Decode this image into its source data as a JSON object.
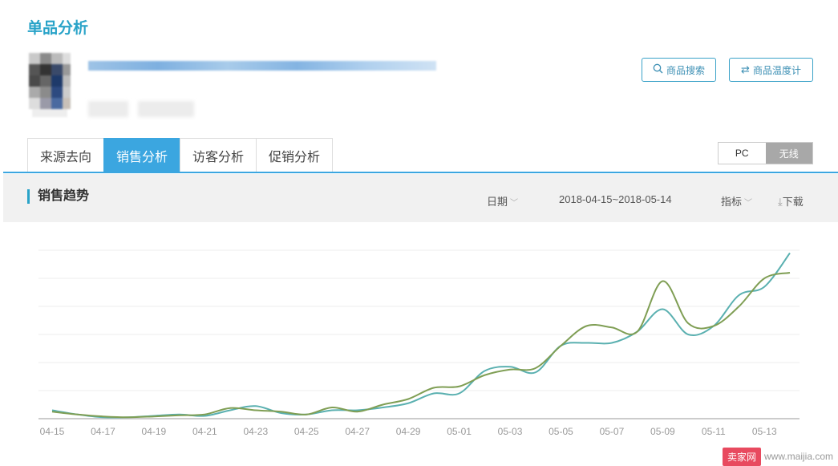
{
  "page_title": "单品分析",
  "header_buttons": {
    "search_label": "商品搜索",
    "thermo_label": "商品温度计"
  },
  "tabs": [
    {
      "label": "来源去向",
      "active": false
    },
    {
      "label": "销售分析",
      "active": true
    },
    {
      "label": "访客分析",
      "active": false
    },
    {
      "label": "促销分析",
      "active": false
    }
  ],
  "device_toggle": {
    "pc": "PC",
    "wireless": "无线",
    "selected": "无线"
  },
  "section": {
    "title": "销售趋势",
    "date_label": "日期",
    "date_range": "2018-04-15~2018-05-14",
    "metric_label": "指标",
    "download_label": "下载"
  },
  "watermark": {
    "logo": "卖家网",
    "url": "www.maijia.com"
  },
  "colors": {
    "accent": "#29a3c8",
    "tab_active": "#3ba6e0",
    "series_teal": "#5ab0b0",
    "series_olive": "#7f9e54"
  },
  "chart_data": {
    "type": "line",
    "x": [
      "04-15",
      "04-16",
      "04-17",
      "04-18",
      "04-19",
      "04-20",
      "04-21",
      "04-22",
      "04-23",
      "04-24",
      "04-25",
      "04-26",
      "04-27",
      "04-28",
      "04-29",
      "04-30",
      "05-01",
      "05-02",
      "05-03",
      "05-04",
      "05-05",
      "05-06",
      "05-07",
      "05-08",
      "05-09",
      "05-10",
      "05-11",
      "05-12",
      "05-13",
      "05-14"
    ],
    "x_ticks": [
      "04-15",
      "04-17",
      "04-19",
      "04-21",
      "04-23",
      "04-25",
      "04-27",
      "04-29",
      "05-01",
      "05-03",
      "05-05",
      "05-07",
      "05-09",
      "05-11",
      "05-13"
    ],
    "series": [
      {
        "color": "#5ab0b0",
        "values": [
          3,
          1.5,
          0.5,
          0.5,
          1,
          1.5,
          1,
          3,
          4.5,
          2,
          1.5,
          3,
          3,
          4,
          5.5,
          9,
          9,
          17,
          18.5,
          16.5,
          26,
          27,
          27,
          31,
          39,
          30,
          33,
          44,
          47,
          59
        ]
      },
      {
        "color": "#7f9e54",
        "values": [
          2.5,
          1.5,
          0.8,
          0.5,
          0.8,
          1.2,
          1.5,
          3.8,
          3,
          2.5,
          1.5,
          4,
          2.5,
          5,
          7,
          11,
          11.5,
          15.5,
          17.5,
          18,
          26,
          33,
          32.5,
          31,
          49,
          34,
          33,
          40,
          50,
          52
        ]
      }
    ],
    "ylim": [
      0,
      60
    ],
    "grid": true
  }
}
